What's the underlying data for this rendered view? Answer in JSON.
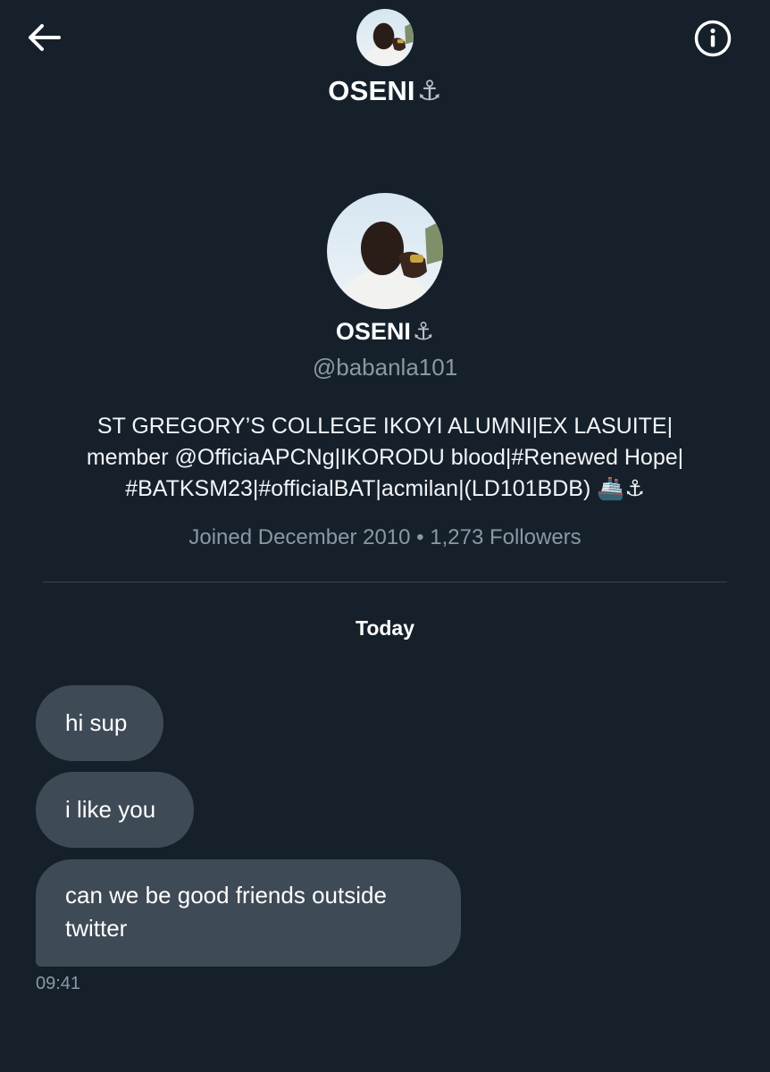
{
  "header": {
    "name": "OSENI",
    "name_emoji": "⚓",
    "back_icon": "arrow-left-icon",
    "info_icon": "info-circle-icon"
  },
  "profile": {
    "name": "OSENI",
    "name_emoji": "⚓",
    "handle": "@babanla101",
    "bio_lines": [
      "ST GREGORY’S COLLEGE IKOYI ALUMNI|EX LASUITE|",
      "member @OfficiaAPCNg|IKORODU blood|#Renewed Hope|",
      "#BATKSM23|#officialBAT|acmilan|(LD101BDB) 🚢⚓"
    ],
    "meta": "Joined December 2010 • 1,273 Followers"
  },
  "conversation": {
    "date_label": "Today",
    "messages": [
      {
        "text": "hi sup"
      },
      {
        "text": "i like you"
      },
      {
        "text": "can we be good friends outside twitter"
      }
    ],
    "last_timestamp": "09:41"
  },
  "colors": {
    "background": "#15202b",
    "bubble": "#3e4a56",
    "secondary_text": "#8b98a5",
    "divider": "#38444d"
  }
}
